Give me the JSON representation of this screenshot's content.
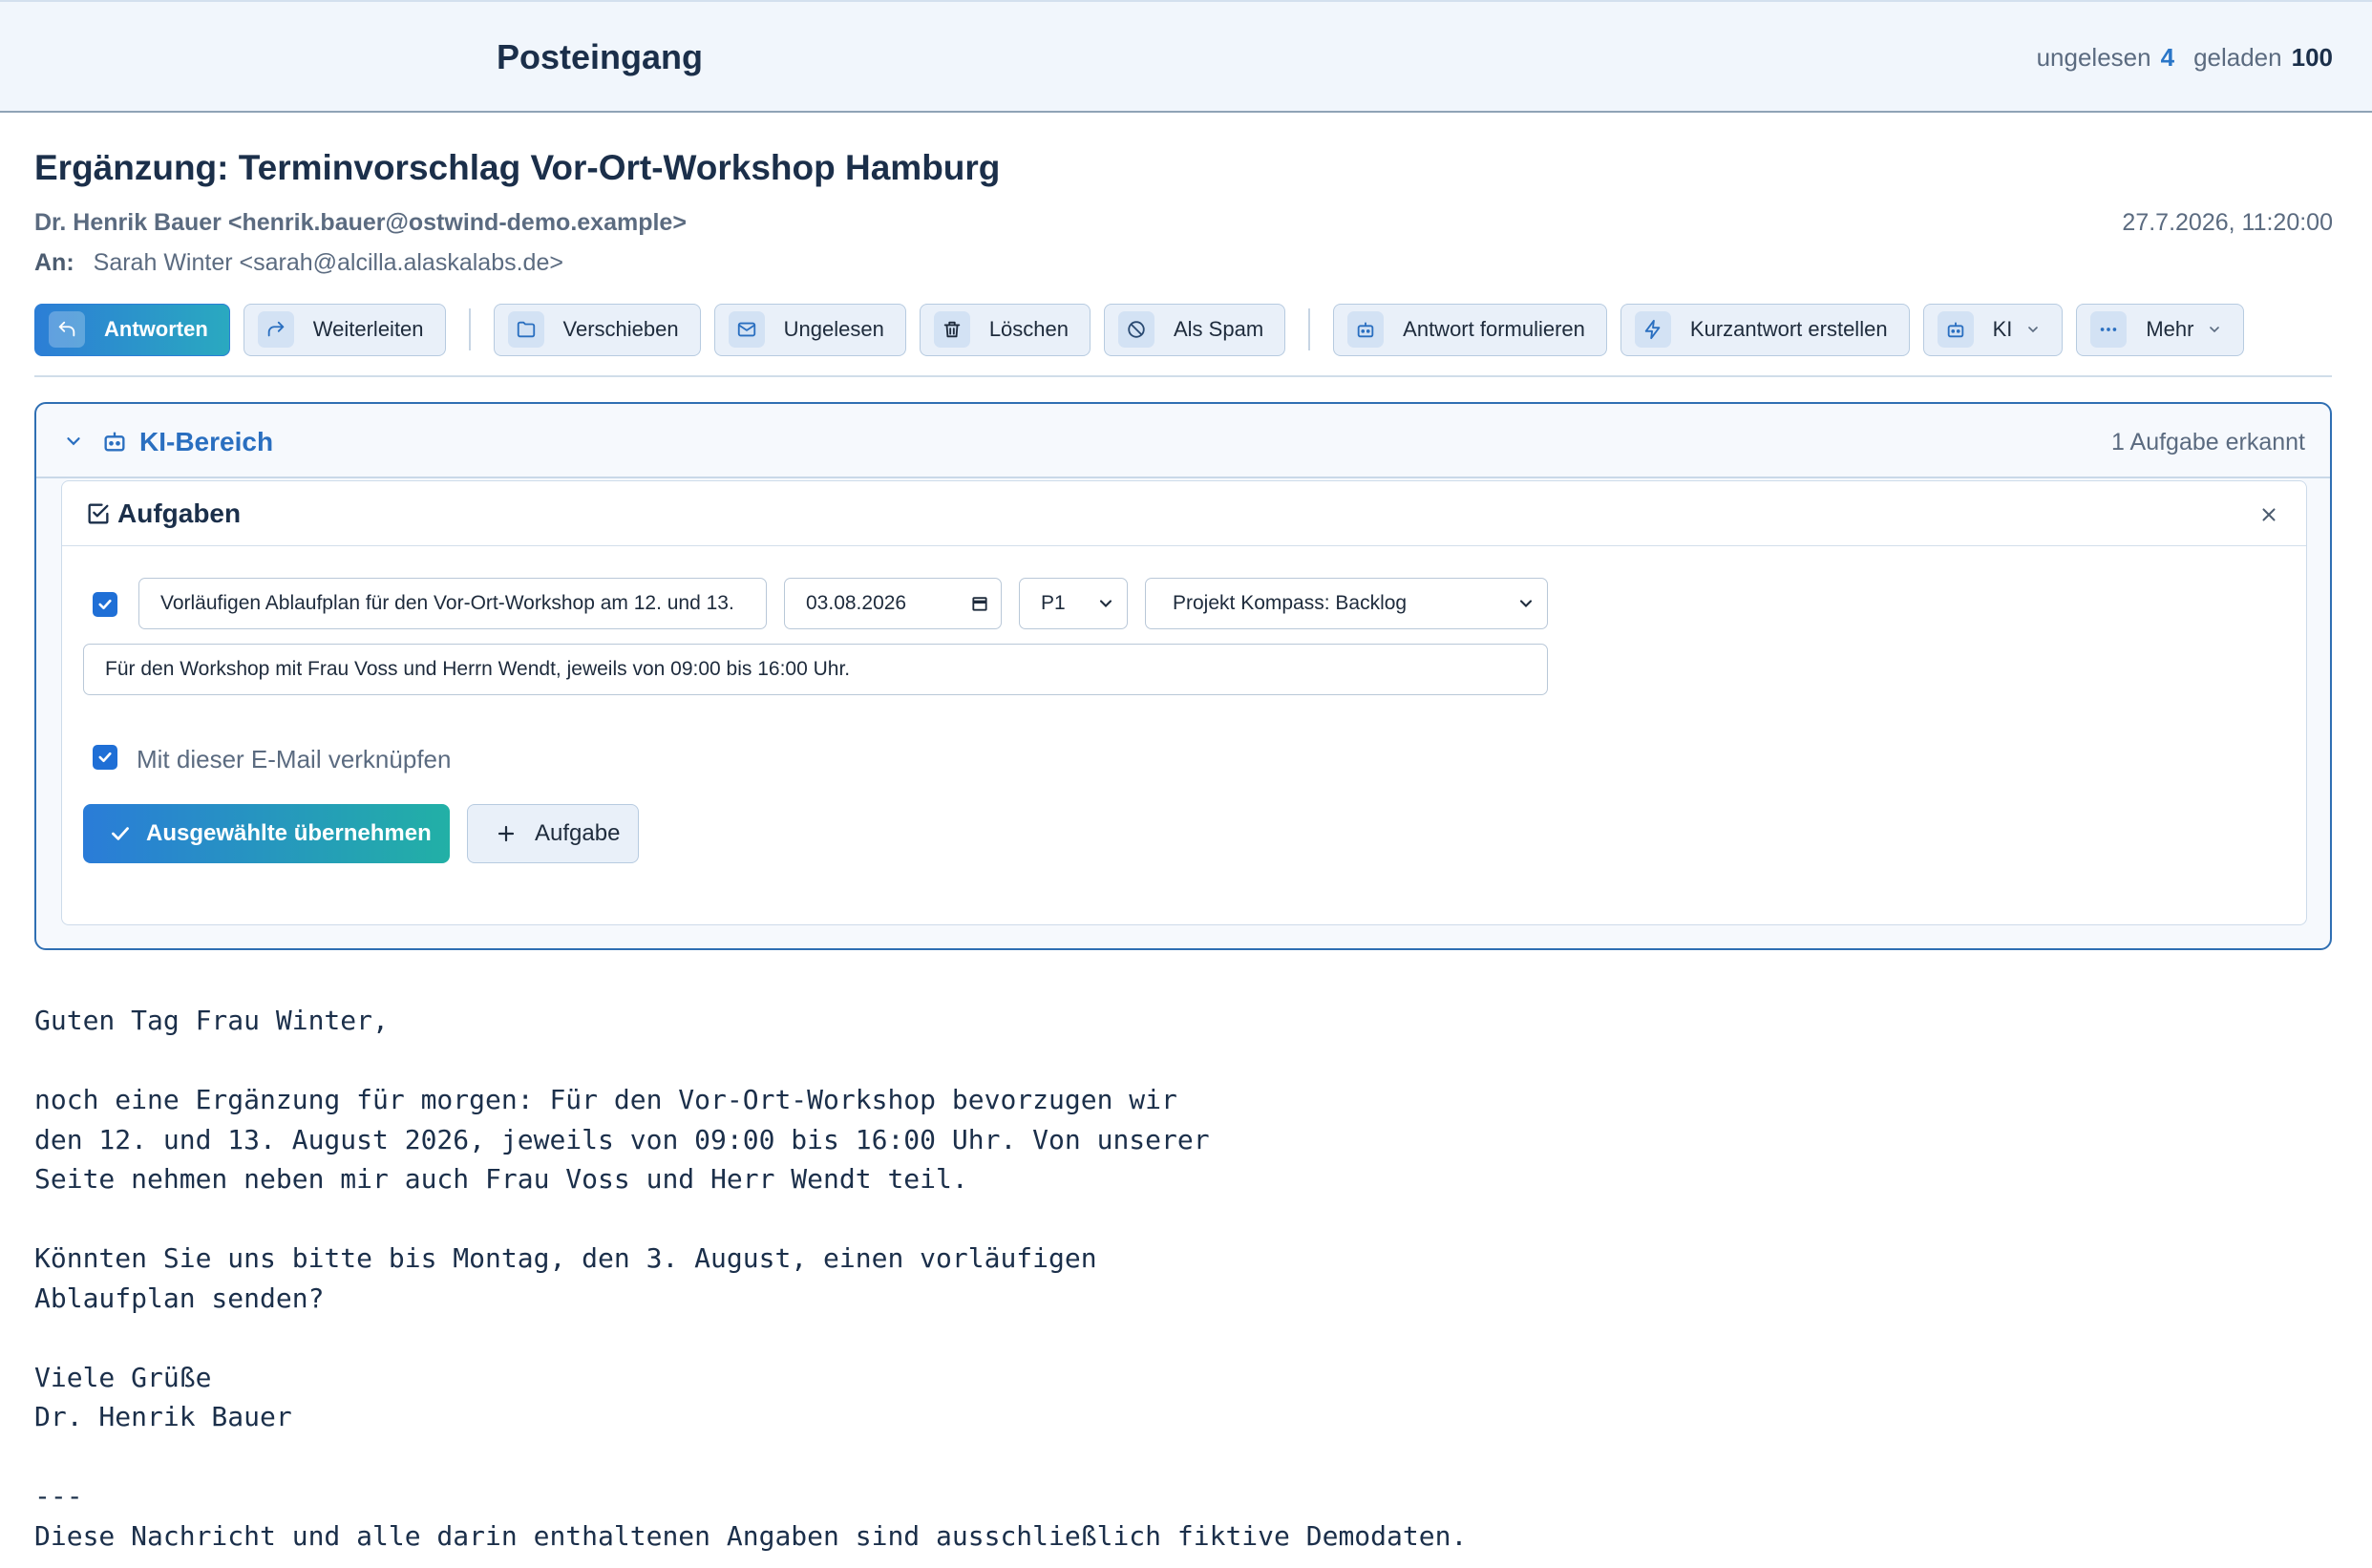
{
  "header": {
    "title": "Posteingang",
    "unread_label": "ungelesen",
    "unread_count": "4",
    "loaded_label": "geladen",
    "loaded_count": "100"
  },
  "message": {
    "subject": "Ergänzung: Terminvorschlag Vor-Ort-Workshop Hamburg",
    "from": "Dr. Henrik Bauer <henrik.bauer@ostwind-demo.example>",
    "date": "27.7.2026, 11:20:00",
    "to_label": "An:",
    "to": "Sarah Winter <sarah@alcilla.alaskalabs.de>"
  },
  "toolbar": {
    "reply": "Antworten",
    "forward": "Weiterleiten",
    "move": "Verschieben",
    "unread": "Ungelesen",
    "delete": "Löschen",
    "spam": "Als Spam",
    "compose_reply": "Antwort formulieren",
    "short_reply": "Kurzantwort erstellen",
    "ai": "KI",
    "more": "Mehr"
  },
  "ki_panel": {
    "title": "KI-Bereich",
    "count_text": "1 Aufgabe erkannt",
    "tasks": {
      "title": "Aufgaben",
      "task_title_value": "Vorläufigen Ablaufplan für den Vor-Ort-Workshop am 12. und 13.",
      "due_date": "03.08.2026",
      "priority": "P1",
      "project": "Projekt Kompass: Backlog",
      "description": "Für den Workshop mit Frau Voss und Herrn Wendt, jeweils von 09:00 bis 16:00 Uhr.",
      "link_label": "Mit dieser E-Mail verknüpfen",
      "apply_button": "Ausgewählte übernehmen",
      "add_button": "Aufgabe"
    }
  },
  "body_text": "Guten Tag Frau Winter,\n\nnoch eine Ergänzung für morgen: Für den Vor-Ort-Workshop bevorzugen wir\nden 12. und 13. August 2026, jeweils von 09:00 bis 16:00 Uhr. Von unserer\nSeite nehmen neben mir auch Frau Voss und Herr Wendt teil.\n\nKönnten Sie uns bitte bis Montag, den 3. August, einen vorläufigen\nAblaufplan senden?\n\nViele Grüße\nDr. Henrik Bauer\n\n---\nDiese Nachricht und alle darin enthaltenen Angaben sind ausschließlich fiktive Demodaten.",
  "colors": {
    "accent": "#2a76c8",
    "primary_gradient_start": "#2c7ed6",
    "primary_gradient_end": "#22b0a6",
    "checkbox": "#1f6fd6"
  },
  "icons": {
    "reply": "reply-arrow-icon",
    "forward": "forward-arrow-icon",
    "move": "folder-icon",
    "unread": "envelope-icon",
    "delete": "trash-icon",
    "spam": "ban-icon",
    "compose": "robot-icon",
    "short_reply": "lightning-icon",
    "more": "ellipsis-icon"
  }
}
